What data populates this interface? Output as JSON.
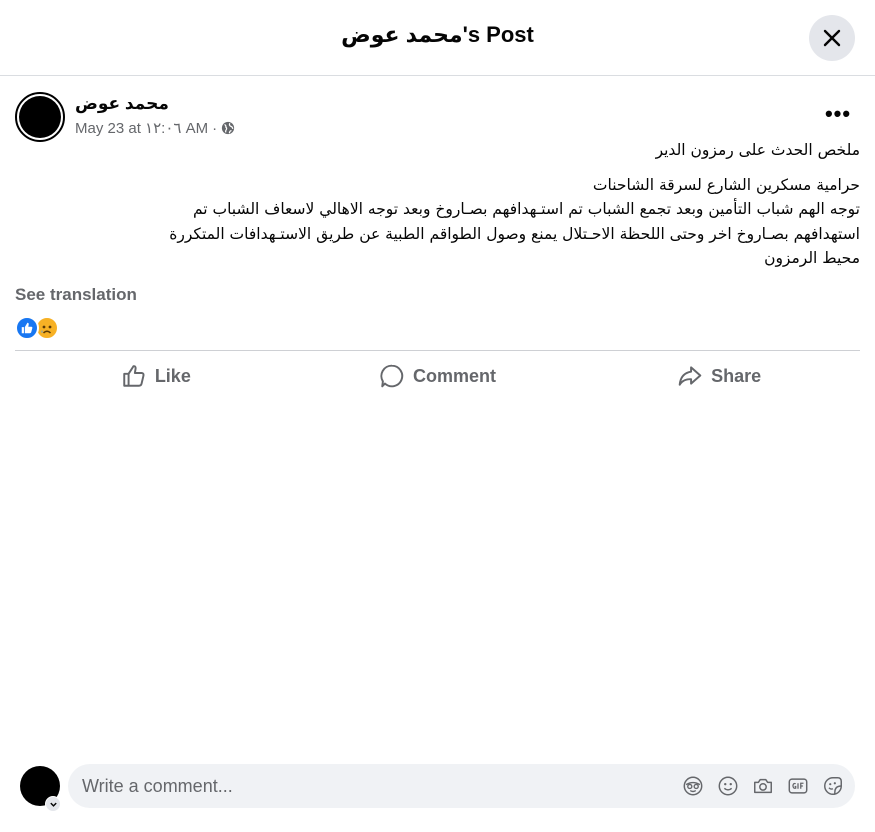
{
  "header": {
    "title": "محمد عوض's Post",
    "close_icon": "close-icon"
  },
  "post": {
    "author": "محمد عوض",
    "date": "May 23 at ١٢:٠٦ AM",
    "separator": "·",
    "privacy_icon": "globe-icon",
    "more_label": "•••",
    "text_lines": [
      "ملخص الحدث على رمزون الدير",
      "حرامية مسكرين الشارع لسرقة الشاحنات",
      "توجه الهم شباب التأمين وبعد تجمع الشباب تم استـهدافهم بصـاروخ وبعد توجه الاهالي لاسعاف الشباب تم",
      "استهدافهم بصـاروخ اخر وحتى اللحظة الاحـتلال يمنع وصول الطواقم الطبية عن طريق الاستـهدافات المتكررة",
      "محيط الرمزون"
    ],
    "see_translation": "See translation",
    "reactions": [
      "like-reaction-icon",
      "sad-reaction-icon"
    ]
  },
  "actions": {
    "like": "Like",
    "comment": "Comment",
    "share": "Share"
  },
  "comment": {
    "placeholder": "Write a comment...",
    "tools": [
      "avatar-sticker-icon",
      "emoji-icon",
      "camera-icon",
      "gif-icon",
      "sticker-icon"
    ]
  },
  "colors": {
    "accent": "#1877f2",
    "secondary_text": "#65676b",
    "surface": "#f0f2f5",
    "button_bg": "#e4e6eb"
  }
}
